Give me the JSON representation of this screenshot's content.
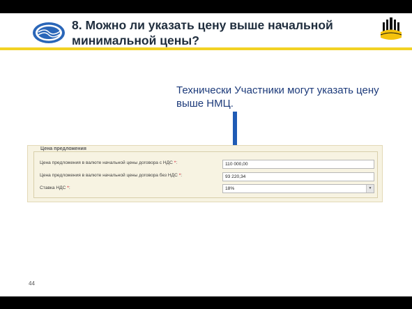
{
  "slide": {
    "title": "8. Можно ли указать цену выше начальной минимальной цены?",
    "note": "Технически Участники могут указать цену выше НМЦ.",
    "page_number": "44"
  },
  "form": {
    "legend": "Цена предложения",
    "rows": [
      {
        "label": "Цена предложения в валюте начальной цены договора с НДС",
        "required": "*",
        "colon": ":",
        "value": "110 000,00"
      },
      {
        "label": "Цена предложения в валюте начальной цены договора без НДС",
        "required": "*",
        "colon": ":",
        "value": "93 220,34"
      },
      {
        "label": "Ставка НДС",
        "required": "*",
        "colon": ":",
        "value": "18%"
      }
    ]
  },
  "colors": {
    "accent_yellow": "#f2d224",
    "arrow_blue": "#1f5bb5",
    "required_red": "#d0021b"
  },
  "icons": {
    "left_logo": "blue-oval-logo",
    "right_logo": "yellow-black-emblem-logo",
    "arrow": "down-arrow-icon",
    "select": "chevron-down-icon"
  }
}
